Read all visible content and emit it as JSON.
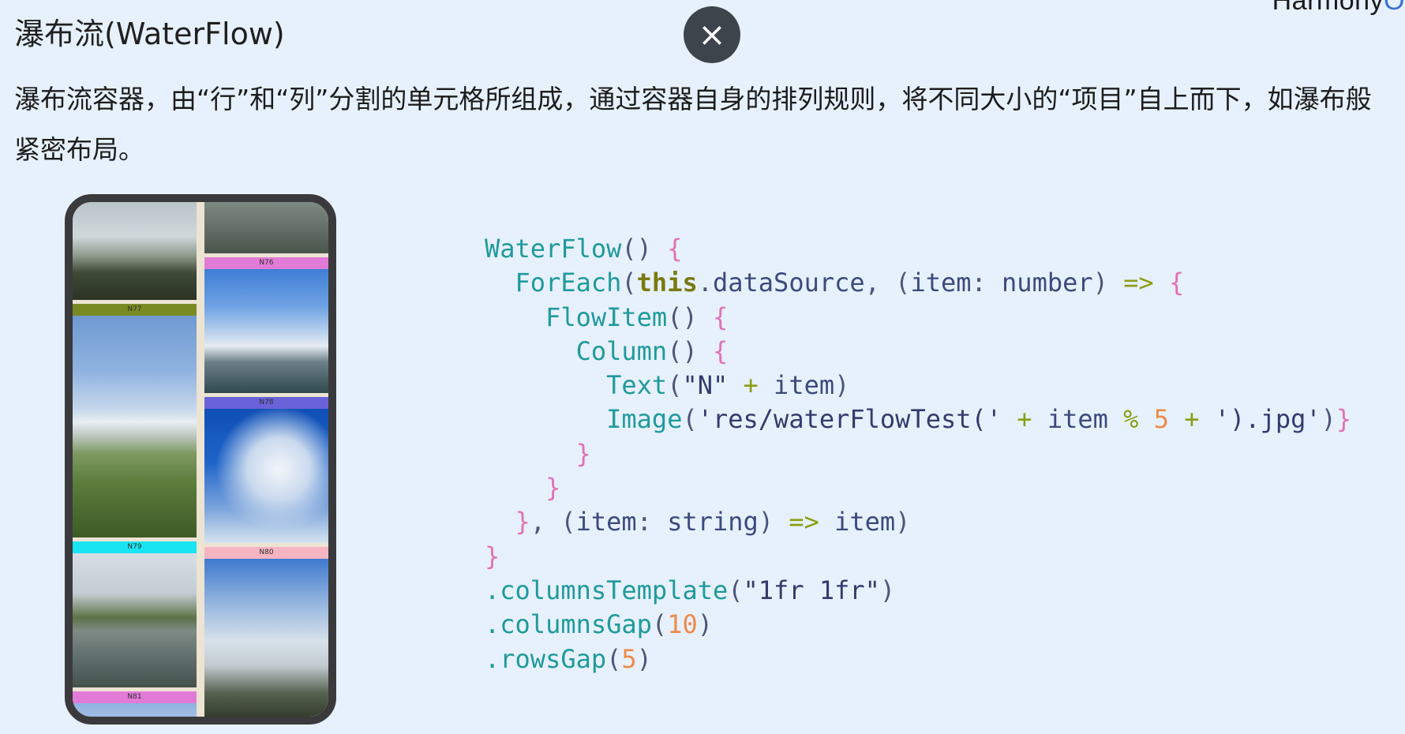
{
  "header": {
    "brand_text": "Harmony",
    "brand_accent": "O",
    "title": "瀑布流(WaterFlow)",
    "close_icon": "close-icon ×"
  },
  "description": "瀑布流容器，由“行”和“列”分割的单元格所组成，通过容器自身的排列规则，将不同大小的“项目”自上而下，如瀑布般紧密布局。",
  "phone_preview": {
    "items": [
      {
        "label": "N76",
        "color": "#e27bd8"
      },
      {
        "label": "N77",
        "color": "#7a8a22"
      },
      {
        "label": "N78",
        "color": "#6a62d8"
      },
      {
        "label": "N79",
        "color": "#19e4f2"
      },
      {
        "label": "N80",
        "color": "#f7b5c3"
      },
      {
        "label": "N81",
        "color": "#e27bd8"
      }
    ]
  },
  "code": {
    "lines": [
      "WaterFlow() {",
      "  ForEach(this.dataSource, (item: number) => {",
      "    FlowItem() {",
      "      Column() {",
      "        Text(\"N\" + item)",
      "        Image('res/waterFlowTest(' + item % 5 + ').jpg')}",
      "      }",
      "    }",
      "  }, (item: string) => item)",
      "}",
      ".columnsTemplate(\"1fr 1fr\")",
      ".columnsGap(10)",
      ".rowsGap(5)"
    ]
  },
  "colors": {
    "background": "#e7f1fd",
    "close_button": "#3d444c",
    "code_function": "#1f9a9d",
    "code_keyword": "#7a7a10",
    "code_brace": "#e072b8",
    "code_number": "#ee8a4a"
  }
}
